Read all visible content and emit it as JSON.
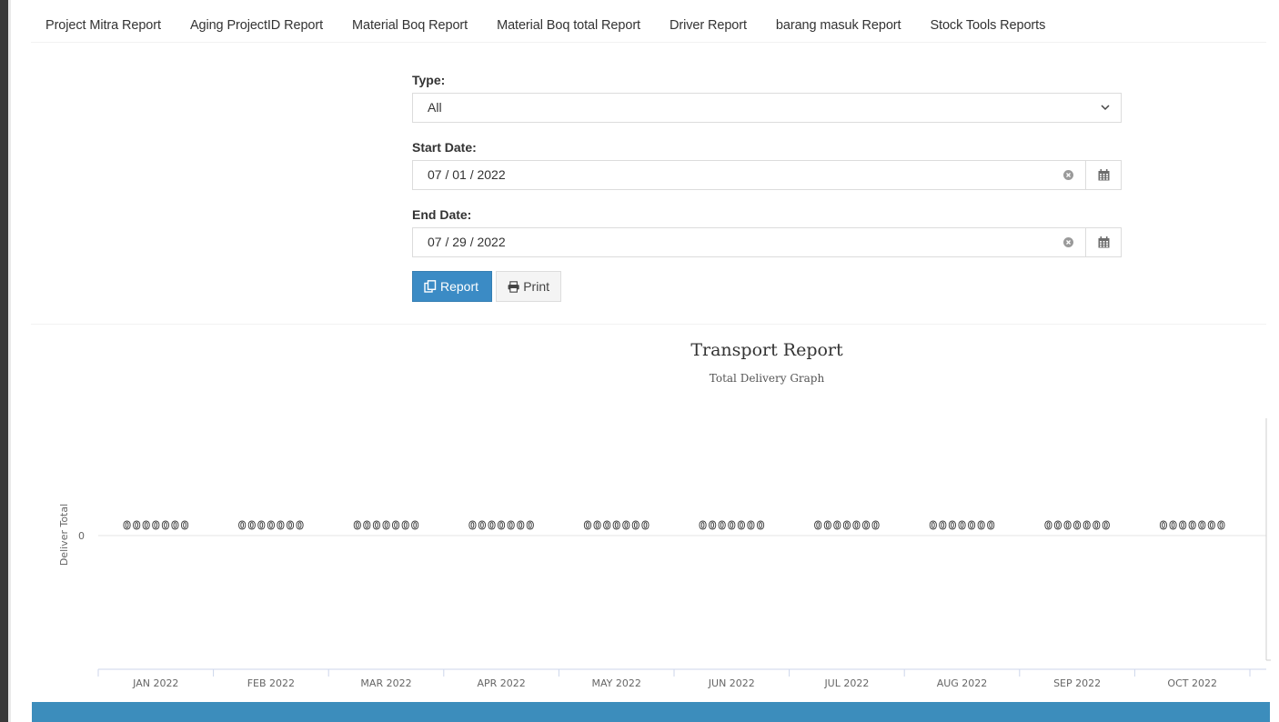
{
  "nav": {
    "items": [
      {
        "label": "Project Mitra Report"
      },
      {
        "label": "Aging ProjectID Report"
      },
      {
        "label": "Material Boq Report"
      },
      {
        "label": "Material Boq total Report"
      },
      {
        "label": "Driver Report"
      },
      {
        "label": "barang masuk Report"
      },
      {
        "label": "Stock Tools Reports"
      }
    ]
  },
  "form": {
    "type_label": "Type:",
    "type_value": "All",
    "start_label": "Start Date:",
    "start_value": "07 / 01 / 2022",
    "end_label": "End Date:",
    "end_value": "07 / 29 / 2022",
    "report_button": "Report",
    "print_button": "Print"
  },
  "chart_data": {
    "type": "bar",
    "title": "Transport Report",
    "subtitle": "Total Delivery Graph",
    "ylabel": "Deliver Total",
    "xlabel": "",
    "yticks": [
      "0"
    ],
    "categories": [
      "JAN 2022",
      "FEB 2022",
      "MAR 2022",
      "APR 2022",
      "MAY 2022",
      "JUN 2022",
      "JUL 2022",
      "AUG 2022",
      "SEP 2022",
      "OCT 2022"
    ],
    "series_count": 7,
    "values": [
      [
        0,
        0,
        0,
        0,
        0,
        0,
        0
      ],
      [
        0,
        0,
        0,
        0,
        0,
        0,
        0
      ],
      [
        0,
        0,
        0,
        0,
        0,
        0,
        0
      ],
      [
        0,
        0,
        0,
        0,
        0,
        0,
        0
      ],
      [
        0,
        0,
        0,
        0,
        0,
        0,
        0
      ],
      [
        0,
        0,
        0,
        0,
        0,
        0,
        0
      ],
      [
        0,
        0,
        0,
        0,
        0,
        0,
        0
      ],
      [
        0,
        0,
        0,
        0,
        0,
        0,
        0
      ],
      [
        0,
        0,
        0,
        0,
        0,
        0,
        0
      ],
      [
        0,
        0,
        0,
        0,
        0,
        0,
        0
      ]
    ]
  },
  "colors": {
    "primary": "#3b8bc5",
    "table_header": "#3c8dbc"
  }
}
